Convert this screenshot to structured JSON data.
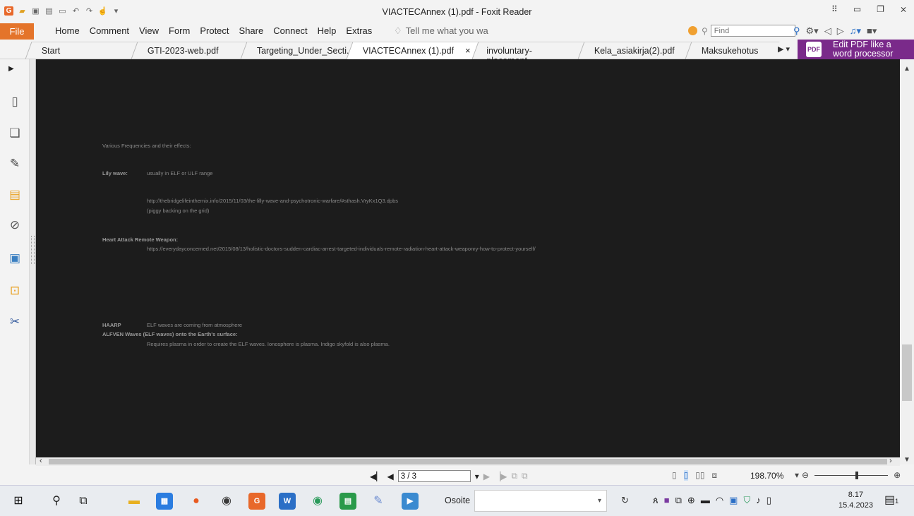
{
  "window": {
    "title": "VIACTECAnnex (1).pdf - Foxit Reader",
    "min_glyph": "▭",
    "restore_glyph": "❐",
    "close_glyph": "⨯"
  },
  "menu": {
    "file": "File",
    "items": [
      "Home",
      "Comment",
      "View",
      "Form",
      "Protect",
      "Share",
      "Connect",
      "Help",
      "Extras"
    ],
    "tell_me": "Tell me what you wa",
    "find_placeholder": "Find"
  },
  "tabs": [
    {
      "label": "Start"
    },
    {
      "label": "GTI-2023-web.pdf"
    },
    {
      "label": "Targeting_Under_Secti..."
    },
    {
      "label": "VIACTECAnnex (1).pdf",
      "active": true
    },
    {
      "label": "involuntary-placement-..."
    },
    {
      "label": "Kela_asiakirja(2).pdf"
    },
    {
      "label": "Maksukehotus"
    }
  ],
  "tab_close": "×",
  "promo": {
    "line1": "Edit PDF like a",
    "line2": "word processor",
    "icon_text": "PDF"
  },
  "left_panel_icons": [
    "page-icon",
    "layers-icon",
    "edit-icon",
    "comment-icon",
    "attachment-icon",
    "signature-icon",
    "lock-icon",
    "tools-icon"
  ],
  "document": {
    "heading": "Various Frequencies and their effects:",
    "lily_label": "Lily wave:",
    "lily_text": "usually in ELF or ULF range",
    "lily_url": "http://thebridgelifeinthemix.info/2015/11/03/the-lilly-wave-and-psychotronic-warfare/#sthash.VryKx1Q3.dpbs",
    "lily_note": "(piggy backing on the grid)",
    "heart_label": "Heart Attack Remote Weapon:",
    "heart_url": "https://everydayconcerned.net/2015/08/13/holistic-doctors-sudden-cardiac-arrest-targeted-individuals-remote-radiation-heart-attack-weaponry-how-to-protect-yourself/",
    "haarp_label": "HAARP",
    "haarp_text": "ELF waves are coming from atmosphere",
    "alfven_label": "ALFVEN Waves (ELF waves) onto the Earth's surface:",
    "alfven_text": "Requires plasma in order to create the ELF waves.  Ionosphere is plasma.  Indigo skyfold is also plasma."
  },
  "status": {
    "page": "3 / 3",
    "zoom": "198.70%"
  },
  "taskbar": {
    "address_label": "Osoite",
    "time": "8.17",
    "date": "15.4.2023",
    "notif_count": "1"
  }
}
